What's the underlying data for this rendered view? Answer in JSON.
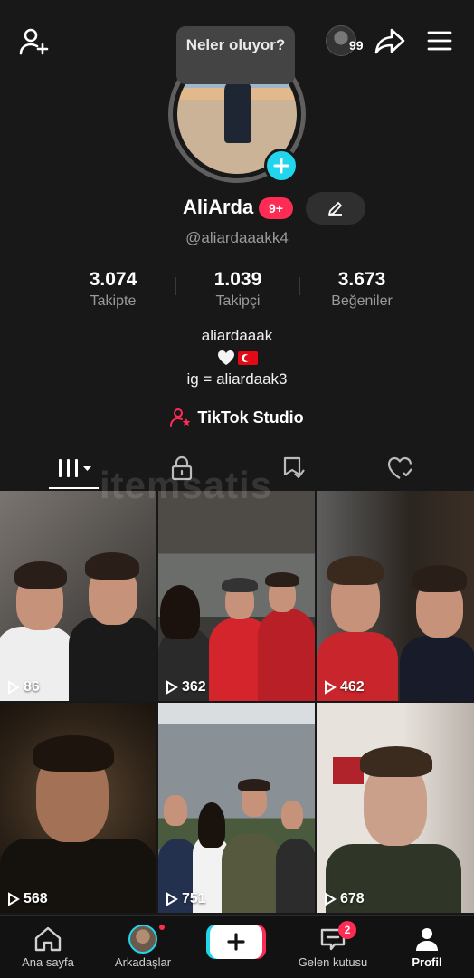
{
  "header": {
    "story_count": "99",
    "tooltip": "Neler oluyor?"
  },
  "profile": {
    "display_name": "AliArda",
    "badge": "9+",
    "handle": "@aliardaaakk4",
    "stats": [
      {
        "value": "3.074",
        "label": "Takipte"
      },
      {
        "value": "1.039",
        "label": "Takipçi"
      },
      {
        "value": "3.673",
        "label": "Beğeniler"
      }
    ],
    "bio_line1": "aliardaaak",
    "bio_line3": "ig = aliardaak3",
    "studio_label": "TikTok Studio"
  },
  "watermark": "itemsatis",
  "videos": [
    {
      "views": "86"
    },
    {
      "views": "362"
    },
    {
      "views": "462"
    },
    {
      "views": "568"
    },
    {
      "views": "751"
    },
    {
      "views": "678"
    }
  ],
  "bottom_nav": {
    "home": "Ana sayfa",
    "friends": "Arkadaşlar",
    "inbox": "Gelen kutusu",
    "inbox_badge": "2",
    "profile": "Profil"
  },
  "colors": {
    "accent_red": "#fe2c55",
    "accent_cyan": "#20d5ec",
    "background": "#181818"
  }
}
